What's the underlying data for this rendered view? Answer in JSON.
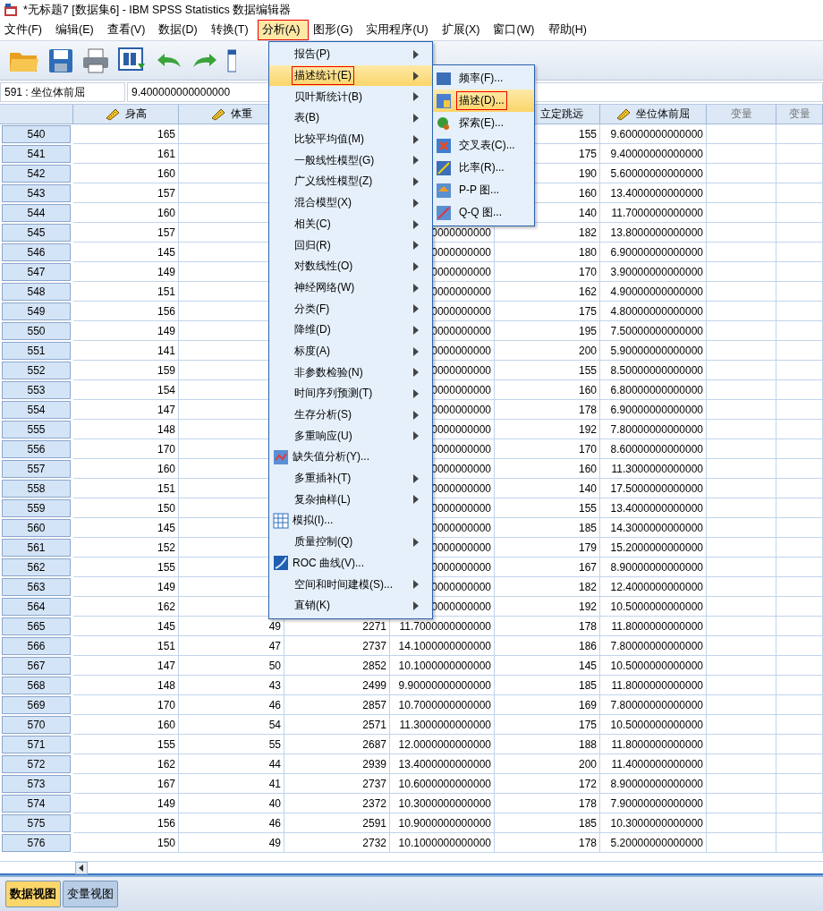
{
  "window": {
    "title": "*无标题7 [数据集6] - IBM SPSS Statistics 数据编辑器"
  },
  "menubar": [
    {
      "label": "文件(F)",
      "selected": false,
      "marked": false
    },
    {
      "label": "编辑(E)",
      "selected": false,
      "marked": false
    },
    {
      "label": "查看(V)",
      "selected": false,
      "marked": false
    },
    {
      "label": "数据(D)",
      "selected": false,
      "marked": false
    },
    {
      "label": "转换(T)",
      "selected": false,
      "marked": false
    },
    {
      "label": "分析(A)",
      "selected": true,
      "marked": true
    },
    {
      "label": "图形(G)",
      "selected": false,
      "marked": false
    },
    {
      "label": "实用程序(U)",
      "selected": false,
      "marked": false
    },
    {
      "label": "扩展(X)",
      "selected": false,
      "marked": false
    },
    {
      "label": "窗口(W)",
      "selected": false,
      "marked": false
    },
    {
      "label": "帮助(H)",
      "selected": false,
      "marked": false
    }
  ],
  "cell_editor": {
    "reference": "591 : 坐位体前屈",
    "value": "9.400000000000000"
  },
  "columns": [
    {
      "label": "身高",
      "kind": "scale"
    },
    {
      "label": "体重",
      "kind": "scale"
    },
    {
      "kind": "hidden"
    },
    {
      "kind": "hidden"
    },
    {
      "label": "立定跳远",
      "kind": "plain"
    },
    {
      "label": "坐位体前屈",
      "kind": "scale"
    },
    {
      "label": "变量",
      "kind": "empty"
    },
    {
      "label": "变量",
      "kind": "empty"
    }
  ],
  "rows": [
    {
      "label": "540",
      "cells": {
        "0": "165",
        "4": "155",
        "5": "9.60000000000000"
      }
    },
    {
      "label": "541",
      "cells": {
        "0": "161",
        "4": "175",
        "5": "9.40000000000000"
      }
    },
    {
      "label": "542",
      "cells": {
        "0": "160",
        "4": "190",
        "5": "5.60000000000000"
      }
    },
    {
      "label": "543",
      "cells": {
        "0": "157",
        "4": "160",
        "5": "13.4000000000000"
      }
    },
    {
      "label": "544",
      "cells": {
        "0": "160",
        "4": "140",
        "5": "11.7000000000000"
      }
    },
    {
      "label": "545",
      "cells": {
        "0": "157",
        "3": "0000000000",
        "4": "182",
        "5": "13.8000000000000"
      }
    },
    {
      "label": "546",
      "cells": {
        "0": "145",
        "3": "0000000000",
        "4": "180",
        "5": "6.90000000000000"
      }
    },
    {
      "label": "547",
      "cells": {
        "0": "149",
        "3": "0000000000",
        "4": "170",
        "5": "3.90000000000000"
      }
    },
    {
      "label": "548",
      "cells": {
        "0": "151",
        "3": "0000000000",
        "4": "162",
        "5": "4.90000000000000"
      }
    },
    {
      "label": "549",
      "cells": {
        "0": "156",
        "3": "0000000000",
        "4": "175",
        "5": "4.80000000000000"
      }
    },
    {
      "label": "550",
      "cells": {
        "0": "149",
        "3": "0000000000",
        "4": "195",
        "5": "7.50000000000000"
      }
    },
    {
      "label": "551",
      "cells": {
        "0": "141",
        "3": "0000000000",
        "4": "200",
        "5": "5.90000000000000"
      }
    },
    {
      "label": "552",
      "cells": {
        "0": "159",
        "3": "0000000000",
        "4": "155",
        "5": "8.50000000000000"
      }
    },
    {
      "label": "553",
      "cells": {
        "0": "154",
        "3": "0000000000",
        "4": "160",
        "5": "6.80000000000000"
      }
    },
    {
      "label": "554",
      "cells": {
        "0": "147",
        "3": "0000000000",
        "4": "178",
        "5": "6.90000000000000"
      }
    },
    {
      "label": "555",
      "cells": {
        "0": "148",
        "3": "0000000000",
        "4": "192",
        "5": "7.80000000000000"
      }
    },
    {
      "label": "556",
      "cells": {
        "0": "170",
        "3": "0000000000",
        "4": "170",
        "5": "8.60000000000000"
      }
    },
    {
      "label": "557",
      "cells": {
        "0": "160",
        "3": "0000000000",
        "4": "160",
        "5": "11.3000000000000"
      }
    },
    {
      "label": "558",
      "cells": {
        "0": "151",
        "3": "0000000000",
        "4": "140",
        "5": "17.5000000000000"
      }
    },
    {
      "label": "559",
      "cells": {
        "0": "150",
        "3": "0000000000",
        "4": "155",
        "5": "13.4000000000000"
      }
    },
    {
      "label": "560",
      "cells": {
        "0": "145",
        "3": "0000000000",
        "4": "185",
        "5": "14.3000000000000"
      }
    },
    {
      "label": "561",
      "cells": {
        "0": "152",
        "3": "0000000000",
        "4": "179",
        "5": "15.2000000000000"
      }
    },
    {
      "label": "562",
      "cells": {
        "0": "155",
        "3": "0000000000",
        "4": "167",
        "5": "8.90000000000000"
      }
    },
    {
      "label": "563",
      "cells": {
        "0": "149",
        "3": "0000000000",
        "4": "182",
        "5": "12.4000000000000"
      }
    },
    {
      "label": "564",
      "cells": {
        "0": "162",
        "3": "0000000000",
        "4": "192",
        "5": "10.5000000000000"
      }
    },
    {
      "label": "565",
      "cells": {
        "0": "145",
        "1": "49",
        "2": "2271",
        "3": "11.7000000000000",
        "4": "178",
        "5": "11.8000000000000"
      }
    },
    {
      "label": "566",
      "cells": {
        "0": "151",
        "1": "47",
        "2": "2737",
        "3": "14.1000000000000",
        "4": "186",
        "5": "7.80000000000000"
      }
    },
    {
      "label": "567",
      "cells": {
        "0": "147",
        "1": "50",
        "2": "2852",
        "3": "10.1000000000000",
        "4": "145",
        "5": "10.5000000000000"
      }
    },
    {
      "label": "568",
      "cells": {
        "0": "148",
        "1": "43",
        "2": "2499",
        "3": "9.90000000000000",
        "4": "185",
        "5": "11.8000000000000"
      }
    },
    {
      "label": "569",
      "cells": {
        "0": "170",
        "1": "46",
        "2": "2857",
        "3": "10.7000000000000",
        "4": "169",
        "5": "7.80000000000000"
      }
    },
    {
      "label": "570",
      "cells": {
        "0": "160",
        "1": "54",
        "2": "2571",
        "3": "11.3000000000000",
        "4": "175",
        "5": "10.5000000000000"
      }
    },
    {
      "label": "571",
      "cells": {
        "0": "155",
        "1": "55",
        "2": "2687",
        "3": "12.0000000000000",
        "4": "188",
        "5": "11.8000000000000"
      }
    },
    {
      "label": "572",
      "cells": {
        "0": "162",
        "1": "44",
        "2": "2939",
        "3": "13.4000000000000",
        "4": "200",
        "5": "11.4000000000000"
      }
    },
    {
      "label": "573",
      "cells": {
        "0": "167",
        "1": "41",
        "2": "2737",
        "3": "10.6000000000000",
        "4": "172",
        "5": "8.90000000000000"
      }
    },
    {
      "label": "574",
      "cells": {
        "0": "149",
        "1": "40",
        "2": "2372",
        "3": "10.3000000000000",
        "4": "178",
        "5": "7.90000000000000"
      }
    },
    {
      "label": "575",
      "cells": {
        "0": "156",
        "1": "46",
        "2": "2591",
        "3": "10.9000000000000",
        "4": "185",
        "5": "10.3000000000000"
      }
    },
    {
      "label": "576",
      "cells": {
        "0": "150",
        "1": "49",
        "2": "2732",
        "3": "10.1000000000000",
        "4": "178",
        "5": "5.20000000000000"
      }
    }
  ],
  "analyze_menu": [
    {
      "label": "报告(P)",
      "kind": "submenu",
      "selected": false,
      "marked": false
    },
    {
      "label": "描述统计(E)",
      "kind": "submenu",
      "selected": true,
      "marked": true
    },
    {
      "label": "贝叶斯统计(B)",
      "kind": "submenu",
      "selected": false,
      "marked": false
    },
    {
      "label": "表(B)",
      "kind": "submenu",
      "selected": false,
      "marked": false
    },
    {
      "label": "比较平均值(M)",
      "kind": "submenu",
      "selected": false,
      "marked": false
    },
    {
      "label": "一般线性模型(G)",
      "kind": "submenu",
      "selected": false,
      "marked": false
    },
    {
      "label": "广义线性模型(Z)",
      "kind": "submenu",
      "selected": false,
      "marked": false
    },
    {
      "label": "混合模型(X)",
      "kind": "submenu",
      "selected": false,
      "marked": false
    },
    {
      "label": "相关(C)",
      "kind": "submenu",
      "selected": false,
      "marked": false
    },
    {
      "label": "回归(R)",
      "kind": "submenu",
      "selected": false,
      "marked": false
    },
    {
      "label": "对数线性(O)",
      "kind": "submenu",
      "selected": false,
      "marked": false
    },
    {
      "label": "神经网络(W)",
      "kind": "submenu",
      "selected": false,
      "marked": false
    },
    {
      "label": "分类(F)",
      "kind": "submenu",
      "selected": false,
      "marked": false
    },
    {
      "label": "降维(D)",
      "kind": "submenu",
      "selected": false,
      "marked": false
    },
    {
      "label": "标度(A)",
      "kind": "submenu",
      "selected": false,
      "marked": false
    },
    {
      "label": "非参数检验(N)",
      "kind": "submenu",
      "selected": false,
      "marked": false
    },
    {
      "label": "时间序列预测(T)",
      "kind": "submenu",
      "selected": false,
      "marked": false
    },
    {
      "label": "生存分析(S)",
      "kind": "submenu",
      "selected": false,
      "marked": false
    },
    {
      "label": "多重响应(U)",
      "kind": "submenu",
      "selected": false,
      "marked": false
    },
    {
      "label": "缺失值分析(Y)...",
      "kind": "action",
      "selected": false,
      "marked": false
    },
    {
      "label": "多重插补(T)",
      "kind": "submenu",
      "selected": false,
      "marked": false
    },
    {
      "label": "复杂抽样(L)",
      "kind": "submenu",
      "selected": false,
      "marked": false
    },
    {
      "label": "模拟(I)...",
      "kind": "action",
      "selected": false,
      "marked": false
    },
    {
      "label": "质量控制(Q)",
      "kind": "submenu",
      "selected": false,
      "marked": false
    },
    {
      "label": "ROC 曲线(V)...",
      "kind": "action",
      "selected": false,
      "marked": false
    },
    {
      "label": "空间和时间建模(S)...",
      "kind": "submenu",
      "selected": false,
      "marked": false
    },
    {
      "label": "直销(K)",
      "kind": "submenu",
      "selected": false,
      "marked": false
    }
  ],
  "descriptives_menu": [
    {
      "label": "频率(F)...",
      "selected": false,
      "marked": false
    },
    {
      "label": "描述(D)...",
      "selected": true,
      "marked": true
    },
    {
      "label": "探索(E)...",
      "selected": false,
      "marked": false
    },
    {
      "label": "交叉表(C)...",
      "selected": false,
      "marked": false
    },
    {
      "label": "比率(R)...",
      "selected": false,
      "marked": false
    },
    {
      "label": "P-P 图...",
      "selected": false,
      "marked": false
    },
    {
      "label": "Q-Q 图...",
      "selected": false,
      "marked": false
    }
  ],
  "view_tabs": [
    {
      "label": "数据视图",
      "selected": true
    },
    {
      "label": "变量视图",
      "selected": false
    }
  ]
}
